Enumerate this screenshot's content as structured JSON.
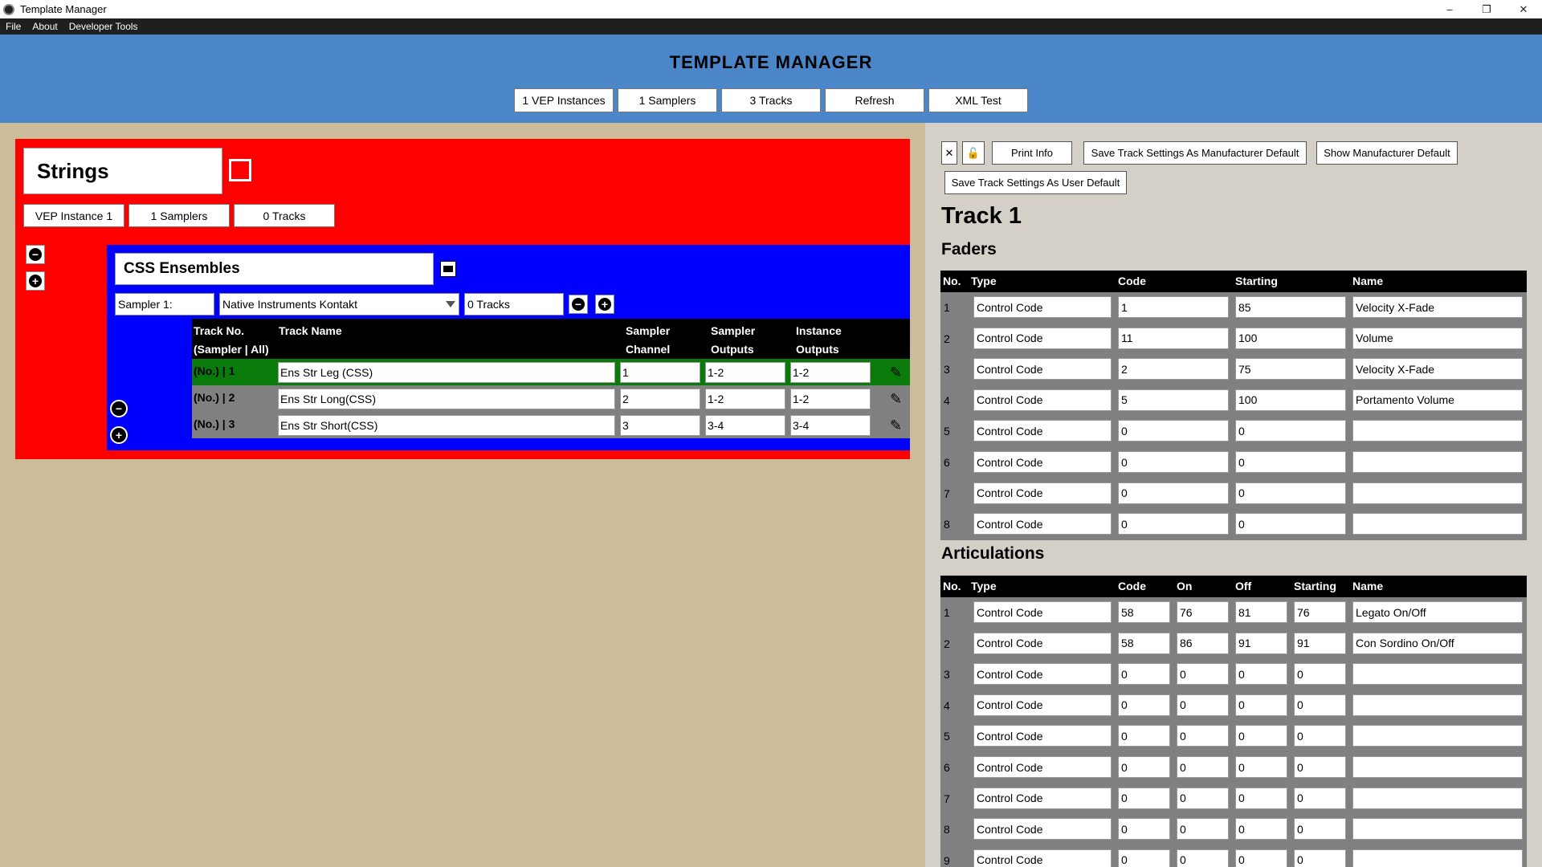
{
  "window": {
    "title": "Template Manager",
    "controls": {
      "minimize": "–",
      "maximize": "❐",
      "close": "✕"
    }
  },
  "menu": [
    "File",
    "About",
    "Developer Tools"
  ],
  "header": {
    "title": "TEMPLATE MANAGER",
    "buttons": [
      "1 VEP Instances",
      "1 Samplers",
      "3 Tracks",
      "Refresh",
      "XML Test"
    ]
  },
  "vep": {
    "name": "Strings",
    "buttons": [
      "VEP Instance 1",
      "1 Samplers",
      "0 Tracks"
    ],
    "color": "#ff0000",
    "sampler": {
      "name": "CSS Ensembles",
      "label": "Sampler 1:",
      "plugin": "Native Instruments Kontakt",
      "tracks": "0 Tracks",
      "color": "#0000ff",
      "columns": {
        "track_no_1": "Track No.",
        "track_no_2": "(Sampler | All)",
        "track_name": "Track Name",
        "sampler_channel_1": "Sampler",
        "sampler_channel_2": "Channel",
        "sampler_outputs_1": "Sampler",
        "sampler_outputs_2": "Outputs",
        "instance_outputs_1": "Instance",
        "instance_outputs_2": "Outputs"
      },
      "rows": [
        {
          "num": "(No.) | 1",
          "name": "Ens Str Leg (CSS)",
          "channel": "1",
          "sampler_out": "1-2",
          "instance_out": "1-2"
        },
        {
          "num": "(No.) | 2",
          "name": "Ens Str Long(CSS)",
          "channel": "2",
          "sampler_out": "1-2",
          "instance_out": "1-2"
        },
        {
          "num": "(No.) | 3",
          "name": "Ens Str Short(CSS)",
          "channel": "3",
          "sampler_out": "3-4",
          "instance_out": "3-4"
        }
      ]
    }
  },
  "right": {
    "close_label": "✕",
    "lock_label": "🔓",
    "print_info": "Print Info",
    "save_manufacturer": "Save Track Settings As Manufacturer Default",
    "show_manufacturer": "Show Manufacturer Default",
    "save_user": "Save Track Settings As User Default",
    "track_title": "Track 1",
    "faders": {
      "title": "Faders",
      "columns": {
        "no": "No.",
        "type": "Type",
        "code": "Code",
        "starting": "Starting",
        "name": "Name"
      },
      "rows": [
        {
          "no": "1",
          "type": "Control Code",
          "code": "1",
          "starting": "85",
          "name": "Velocity X-Fade"
        },
        {
          "no": "2",
          "type": "Control Code",
          "code": "11",
          "starting": "100",
          "name": "Volume"
        },
        {
          "no": "3",
          "type": "Control Code",
          "code": "2",
          "starting": "75",
          "name": "Velocity X-Fade"
        },
        {
          "no": "4",
          "type": "Control Code",
          "code": "5",
          "starting": "100",
          "name": "Portamento Volume"
        },
        {
          "no": "5",
          "type": "Control Code",
          "code": "0",
          "starting": "0",
          "name": ""
        },
        {
          "no": "6",
          "type": "Control Code",
          "code": "0",
          "starting": "0",
          "name": ""
        },
        {
          "no": "7",
          "type": "Control Code",
          "code": "0",
          "starting": "0",
          "name": ""
        },
        {
          "no": "8",
          "type": "Control Code",
          "code": "0",
          "starting": "0",
          "name": ""
        }
      ]
    },
    "articulations": {
      "title": "Articulations",
      "columns": {
        "no": "No.",
        "type": "Type",
        "code": "Code",
        "on": "On",
        "off": "Off",
        "starting": "Starting",
        "name": "Name"
      },
      "rows": [
        {
          "no": "1",
          "type": "Control Code",
          "code": "58",
          "on": "76",
          "off": "81",
          "starting": "76",
          "name": "Legato On/Off"
        },
        {
          "no": "2",
          "type": "Control Code",
          "code": "58",
          "on": "86",
          "off": "91",
          "starting": "91",
          "name": "Con Sordino On/Off"
        },
        {
          "no": "3",
          "type": "Control Code",
          "code": "0",
          "on": "0",
          "off": "0",
          "starting": "0",
          "name": ""
        },
        {
          "no": "4",
          "type": "Control Code",
          "code": "0",
          "on": "0",
          "off": "0",
          "starting": "0",
          "name": ""
        },
        {
          "no": "5",
          "type": "Control Code",
          "code": "0",
          "on": "0",
          "off": "0",
          "starting": "0",
          "name": ""
        },
        {
          "no": "6",
          "type": "Control Code",
          "code": "0",
          "on": "0",
          "off": "0",
          "starting": "0",
          "name": ""
        },
        {
          "no": "7",
          "type": "Control Code",
          "code": "0",
          "on": "0",
          "off": "0",
          "starting": "0",
          "name": ""
        },
        {
          "no": "8",
          "type": "Control Code",
          "code": "0",
          "on": "0",
          "off": "0",
          "starting": "0",
          "name": ""
        },
        {
          "no": "9",
          "type": "Control Code",
          "code": "0",
          "on": "0",
          "off": "0",
          "starting": "0",
          "name": ""
        }
      ]
    }
  }
}
